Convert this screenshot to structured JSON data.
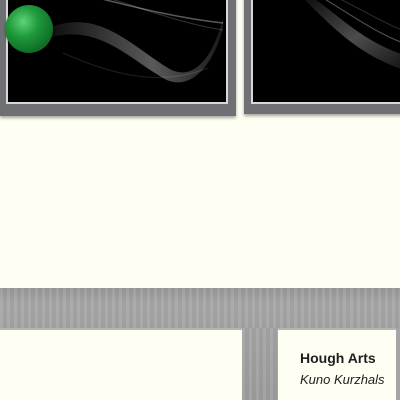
{
  "gallery": {
    "artwork_label": {
      "title": "Hough Arts",
      "artist": "Kuno Kurzhals"
    },
    "marker": {
      "icon": "green-sphere-marker",
      "color": "#1f9a3b"
    },
    "colors": {
      "wall": "#fefef2",
      "floor": "#a3a3a3",
      "frame": "#6f7073",
      "canvas": "#000000"
    }
  }
}
